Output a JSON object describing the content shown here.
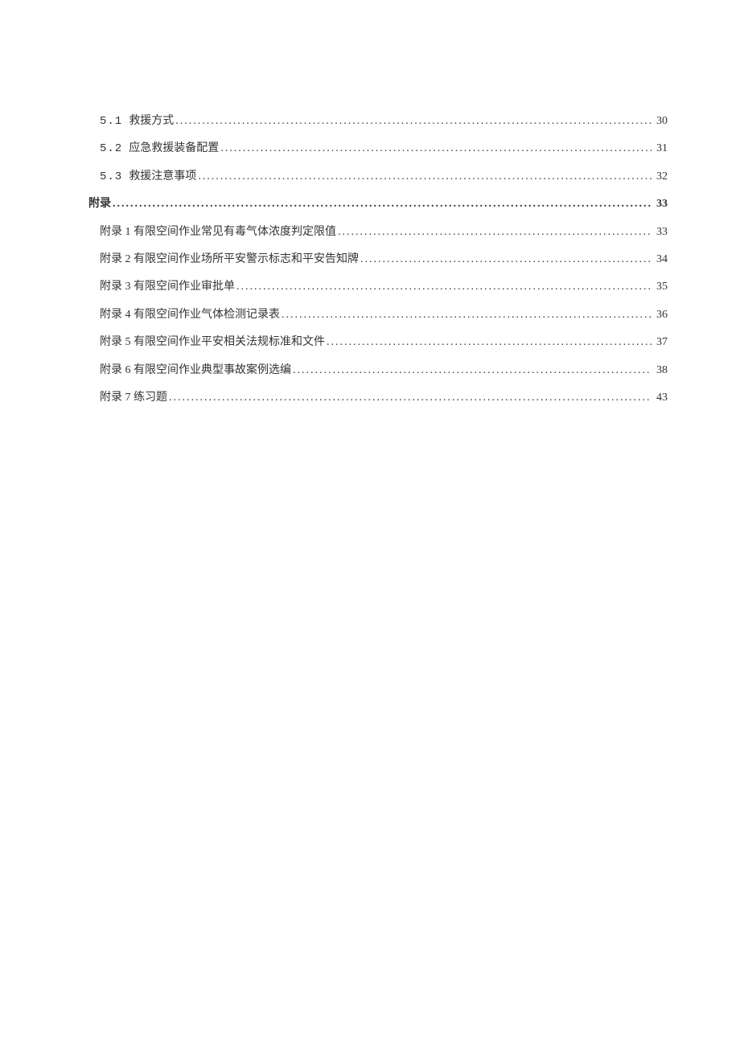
{
  "toc": {
    "entries": [
      {
        "level": 1,
        "num": "5.1",
        "title": "救援方式",
        "page": "30"
      },
      {
        "level": 1,
        "num": "5.2",
        "title": "应急救援装备配置",
        "page": "31"
      },
      {
        "level": 1,
        "num": "5.3",
        "title": "救援注意事项",
        "page": "32"
      },
      {
        "level": 0,
        "num": "",
        "title": "附录",
        "page": "33"
      },
      {
        "level": 2,
        "num": "",
        "title": "附录 1 有限空间作业常见有毒气体浓度判定限值",
        "page": "33"
      },
      {
        "level": 2,
        "num": "",
        "title": "附录 2 有限空间作业场所平安警示标志和平安告知牌",
        "page": "34"
      },
      {
        "level": 2,
        "num": "",
        "title": "附录 3 有限空间作业审批单",
        "page": "35"
      },
      {
        "level": 2,
        "num": "",
        "title": "附录 4 有限空间作业气体检测记录表",
        "page": "36"
      },
      {
        "level": 2,
        "num": "",
        "title": "附录 5 有限空间作业平安相关法规标准和文件",
        "page": "37"
      },
      {
        "level": 2,
        "num": "",
        "title": "附录 6 有限空间作业典型事故案例选编",
        "page": "38"
      },
      {
        "level": 2,
        "num": "",
        "title": "附录 7 练习题",
        "page": "43"
      }
    ]
  }
}
